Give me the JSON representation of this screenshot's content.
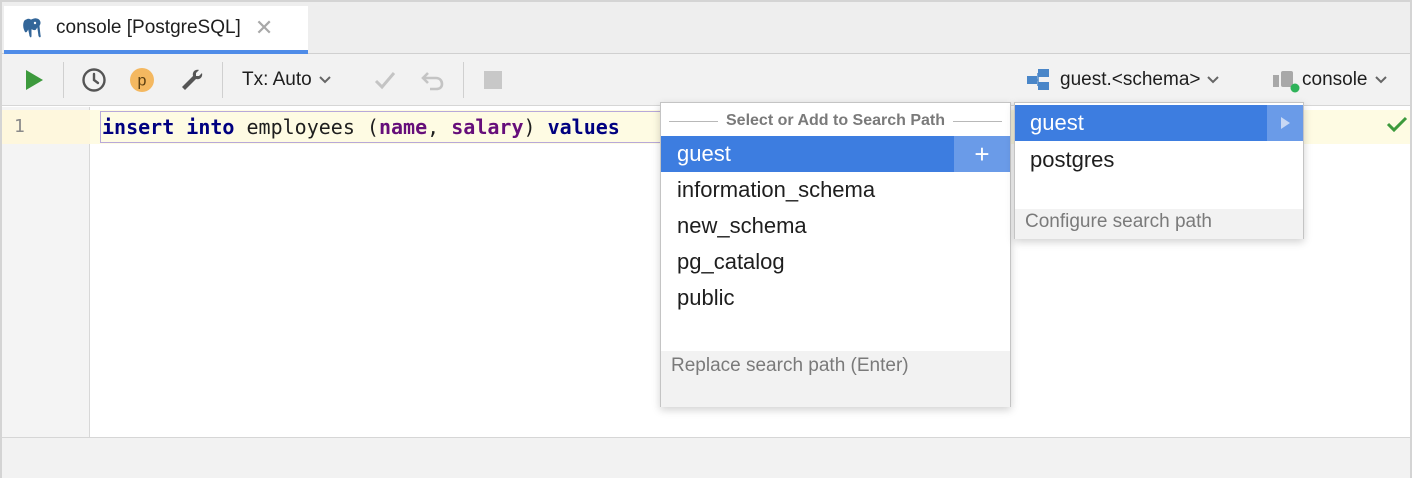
{
  "tab": {
    "label": "console [PostgreSQL]",
    "icon": "postgresql-elephant-icon"
  },
  "toolbar": {
    "tx_label": "Tx: Auto",
    "profiler_badge": "p",
    "schema_selector": "guest.<schema>",
    "session_selector": "console"
  },
  "editor": {
    "line_number": "1",
    "code": {
      "kw_insert": "insert",
      "kw_into": "into",
      "table": " employees (",
      "field_name": "name",
      "comma": ", ",
      "field_salary": "salary",
      "close": ") ",
      "kw_values": "values"
    }
  },
  "search_path_popup": {
    "title": "Select or Add to Search Path",
    "items": [
      "guest",
      "information_schema",
      "new_schema",
      "pg_catalog",
      "public"
    ],
    "selected_index": 0,
    "add_button": "+",
    "footer": "Replace search path (Enter)"
  },
  "schema_popup": {
    "items": [
      "guest",
      "postgres"
    ],
    "selected_index": 0,
    "footer": "Configure search path"
  },
  "colors": {
    "selection": "#3d7de0",
    "selection_secondary": "#6a9be8",
    "keyword": "#000080",
    "field": "#660e7a",
    "run_green": "#3d9a3d",
    "tab_underline": "#4f8ce8"
  }
}
